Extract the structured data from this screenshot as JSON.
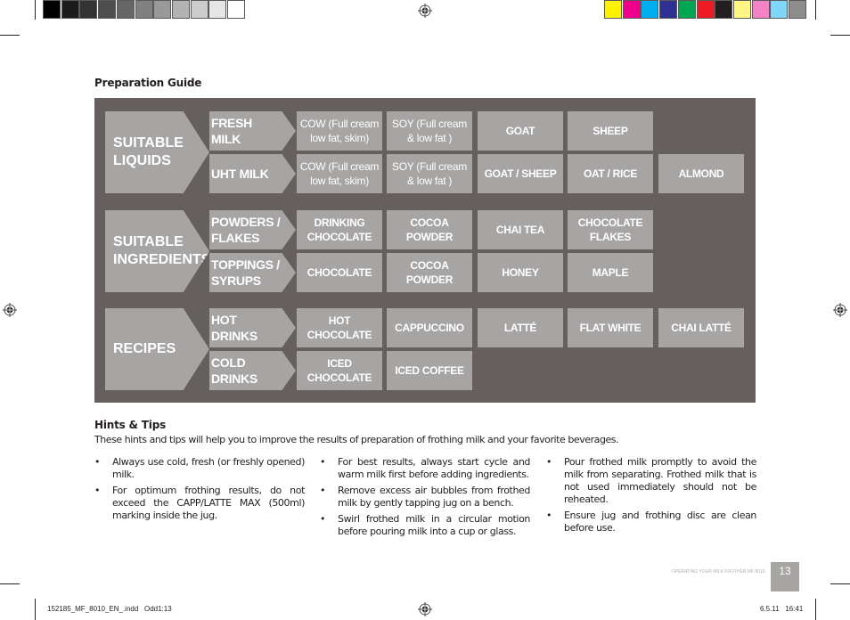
{
  "print_marks": {
    "grayscale_swatches": [
      "#000000",
      "#1c1c1c",
      "#333333",
      "#4d4d4d",
      "#666666",
      "#808080",
      "#999999",
      "#b3b3b3",
      "#cccccc",
      "#e6e6e6",
      "#ffffff"
    ],
    "color_swatches": [
      "#fff200",
      "#ec008c",
      "#00aeef",
      "#2e3192",
      "#00a651",
      "#ed1c24",
      "#231f20",
      "#fff685",
      "#f682c6",
      "#7fd6f7",
      "#8e8c8c"
    ]
  },
  "preparation_guide": {
    "title": "Preparation Guide",
    "sections": [
      {
        "label": "SUITABLE LIQUIDS",
        "rows": [
          {
            "label": "FRESH MILK",
            "items": [
              "COW (Full cream low fat, skim)",
              "SOY (Full cream & low fat )",
              "GOAT",
              "SHEEP"
            ]
          },
          {
            "label": "UHT MILK",
            "items": [
              "COW (Full cream low fat, skim)",
              "SOY (Full cream & low fat )",
              "GOAT / SHEEP",
              "OAT / RICE",
              "ALMOND"
            ]
          }
        ]
      },
      {
        "label": "SUITABLE INGREDIENTS",
        "rows": [
          {
            "label": "POWDERS / FLAKES",
            "items": [
              "DRINKING CHOCOLATE",
              "COCOA POWDER",
              "CHAI TEA",
              "CHOCOLATE FLAKES"
            ]
          },
          {
            "label": "TOPPINGS / SYRUPS",
            "items": [
              "CHOCOLATE",
              "COCOA POWDER",
              "HONEY",
              "MAPLE"
            ]
          }
        ]
      },
      {
        "label": "RECIPES",
        "rows": [
          {
            "label": "HOT DRINKS",
            "items": [
              "HOT CHOCOLATE",
              "CAPPUCCINO",
              "LATTÉ",
              "FLAT WHITE",
              "CHAI LATTÉ"
            ]
          },
          {
            "label": "COLD DRINKS",
            "items": [
              "ICED CHOCOLATE",
              "ICED COFFEE"
            ]
          }
        ]
      }
    ]
  },
  "hints": {
    "title": "Hints & Tips",
    "intro": "These hints and tips will help you to improve the results of preparation of frothing milk and your favorite beverages.",
    "columns": [
      [
        "Always use cold, fresh (or freshly opened) milk.",
        "For optimum frothing results, do not exceed the CAPP/LATTE MAX (500ml) marking inside the jug."
      ],
      [
        "For best results, always start cycle and warm milk first before adding ingredients.",
        "Remove excess air bubbles from frothed milk by gently tapping jug on a bench.",
        "Swirl frothed milk in a circular motion before pouring milk into a cup or glass."
      ],
      [
        "Pour frothed milk promptly to avoid the milk from separating. Frothed milk that is not used immediately should not be reheated.",
        "Ensure jug and frothing disc are clean before use."
      ]
    ],
    "bullet": "•"
  },
  "footer": {
    "running_header": "OPERATING YOUR MILK FROTHER MF 8010",
    "page_number": "13",
    "slug_file": "152185_MF_8010_EN_.indd   Odd1:13",
    "slug_date": "6.5.11   16:41"
  },
  "colors": {
    "panel_bg": "#655f5e",
    "cell_bg": "#a7a4a4",
    "cell_text": "#ffffff",
    "page_number_bg": "#a7a4a4"
  }
}
